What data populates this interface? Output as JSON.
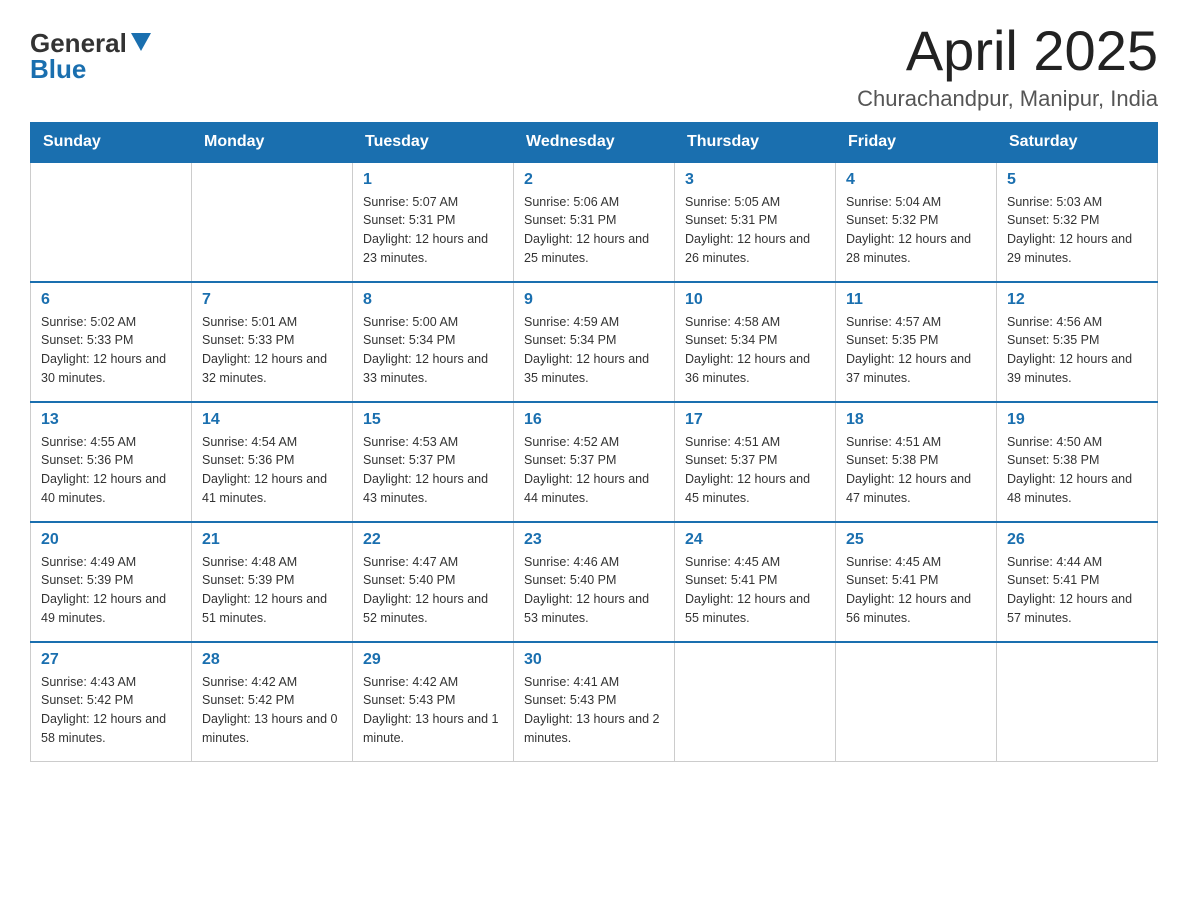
{
  "logo": {
    "general": "General",
    "blue": "Blue"
  },
  "title": "April 2025",
  "subtitle": "Churachandpur, Manipur, India",
  "days_of_week": [
    "Sunday",
    "Monday",
    "Tuesday",
    "Wednesday",
    "Thursday",
    "Friday",
    "Saturday"
  ],
  "weeks": [
    [
      {
        "day": "",
        "sunrise": "",
        "sunset": "",
        "daylight": ""
      },
      {
        "day": "",
        "sunrise": "",
        "sunset": "",
        "daylight": ""
      },
      {
        "day": "1",
        "sunrise": "Sunrise: 5:07 AM",
        "sunset": "Sunset: 5:31 PM",
        "daylight": "Daylight: 12 hours and 23 minutes."
      },
      {
        "day": "2",
        "sunrise": "Sunrise: 5:06 AM",
        "sunset": "Sunset: 5:31 PM",
        "daylight": "Daylight: 12 hours and 25 minutes."
      },
      {
        "day": "3",
        "sunrise": "Sunrise: 5:05 AM",
        "sunset": "Sunset: 5:31 PM",
        "daylight": "Daylight: 12 hours and 26 minutes."
      },
      {
        "day": "4",
        "sunrise": "Sunrise: 5:04 AM",
        "sunset": "Sunset: 5:32 PM",
        "daylight": "Daylight: 12 hours and 28 minutes."
      },
      {
        "day": "5",
        "sunrise": "Sunrise: 5:03 AM",
        "sunset": "Sunset: 5:32 PM",
        "daylight": "Daylight: 12 hours and 29 minutes."
      }
    ],
    [
      {
        "day": "6",
        "sunrise": "Sunrise: 5:02 AM",
        "sunset": "Sunset: 5:33 PM",
        "daylight": "Daylight: 12 hours and 30 minutes."
      },
      {
        "day": "7",
        "sunrise": "Sunrise: 5:01 AM",
        "sunset": "Sunset: 5:33 PM",
        "daylight": "Daylight: 12 hours and 32 minutes."
      },
      {
        "day": "8",
        "sunrise": "Sunrise: 5:00 AM",
        "sunset": "Sunset: 5:34 PM",
        "daylight": "Daylight: 12 hours and 33 minutes."
      },
      {
        "day": "9",
        "sunrise": "Sunrise: 4:59 AM",
        "sunset": "Sunset: 5:34 PM",
        "daylight": "Daylight: 12 hours and 35 minutes."
      },
      {
        "day": "10",
        "sunrise": "Sunrise: 4:58 AM",
        "sunset": "Sunset: 5:34 PM",
        "daylight": "Daylight: 12 hours and 36 minutes."
      },
      {
        "day": "11",
        "sunrise": "Sunrise: 4:57 AM",
        "sunset": "Sunset: 5:35 PM",
        "daylight": "Daylight: 12 hours and 37 minutes."
      },
      {
        "day": "12",
        "sunrise": "Sunrise: 4:56 AM",
        "sunset": "Sunset: 5:35 PM",
        "daylight": "Daylight: 12 hours and 39 minutes."
      }
    ],
    [
      {
        "day": "13",
        "sunrise": "Sunrise: 4:55 AM",
        "sunset": "Sunset: 5:36 PM",
        "daylight": "Daylight: 12 hours and 40 minutes."
      },
      {
        "day": "14",
        "sunrise": "Sunrise: 4:54 AM",
        "sunset": "Sunset: 5:36 PM",
        "daylight": "Daylight: 12 hours and 41 minutes."
      },
      {
        "day": "15",
        "sunrise": "Sunrise: 4:53 AM",
        "sunset": "Sunset: 5:37 PM",
        "daylight": "Daylight: 12 hours and 43 minutes."
      },
      {
        "day": "16",
        "sunrise": "Sunrise: 4:52 AM",
        "sunset": "Sunset: 5:37 PM",
        "daylight": "Daylight: 12 hours and 44 minutes."
      },
      {
        "day": "17",
        "sunrise": "Sunrise: 4:51 AM",
        "sunset": "Sunset: 5:37 PM",
        "daylight": "Daylight: 12 hours and 45 minutes."
      },
      {
        "day": "18",
        "sunrise": "Sunrise: 4:51 AM",
        "sunset": "Sunset: 5:38 PM",
        "daylight": "Daylight: 12 hours and 47 minutes."
      },
      {
        "day": "19",
        "sunrise": "Sunrise: 4:50 AM",
        "sunset": "Sunset: 5:38 PM",
        "daylight": "Daylight: 12 hours and 48 minutes."
      }
    ],
    [
      {
        "day": "20",
        "sunrise": "Sunrise: 4:49 AM",
        "sunset": "Sunset: 5:39 PM",
        "daylight": "Daylight: 12 hours and 49 minutes."
      },
      {
        "day": "21",
        "sunrise": "Sunrise: 4:48 AM",
        "sunset": "Sunset: 5:39 PM",
        "daylight": "Daylight: 12 hours and 51 minutes."
      },
      {
        "day": "22",
        "sunrise": "Sunrise: 4:47 AM",
        "sunset": "Sunset: 5:40 PM",
        "daylight": "Daylight: 12 hours and 52 minutes."
      },
      {
        "day": "23",
        "sunrise": "Sunrise: 4:46 AM",
        "sunset": "Sunset: 5:40 PM",
        "daylight": "Daylight: 12 hours and 53 minutes."
      },
      {
        "day": "24",
        "sunrise": "Sunrise: 4:45 AM",
        "sunset": "Sunset: 5:41 PM",
        "daylight": "Daylight: 12 hours and 55 minutes."
      },
      {
        "day": "25",
        "sunrise": "Sunrise: 4:45 AM",
        "sunset": "Sunset: 5:41 PM",
        "daylight": "Daylight: 12 hours and 56 minutes."
      },
      {
        "day": "26",
        "sunrise": "Sunrise: 4:44 AM",
        "sunset": "Sunset: 5:41 PM",
        "daylight": "Daylight: 12 hours and 57 minutes."
      }
    ],
    [
      {
        "day": "27",
        "sunrise": "Sunrise: 4:43 AM",
        "sunset": "Sunset: 5:42 PM",
        "daylight": "Daylight: 12 hours and 58 minutes."
      },
      {
        "day": "28",
        "sunrise": "Sunrise: 4:42 AM",
        "sunset": "Sunset: 5:42 PM",
        "daylight": "Daylight: 13 hours and 0 minutes."
      },
      {
        "day": "29",
        "sunrise": "Sunrise: 4:42 AM",
        "sunset": "Sunset: 5:43 PM",
        "daylight": "Daylight: 13 hours and 1 minute."
      },
      {
        "day": "30",
        "sunrise": "Sunrise: 4:41 AM",
        "sunset": "Sunset: 5:43 PM",
        "daylight": "Daylight: 13 hours and 2 minutes."
      },
      {
        "day": "",
        "sunrise": "",
        "sunset": "",
        "daylight": ""
      },
      {
        "day": "",
        "sunrise": "",
        "sunset": "",
        "daylight": ""
      },
      {
        "day": "",
        "sunrise": "",
        "sunset": "",
        "daylight": ""
      }
    ]
  ]
}
